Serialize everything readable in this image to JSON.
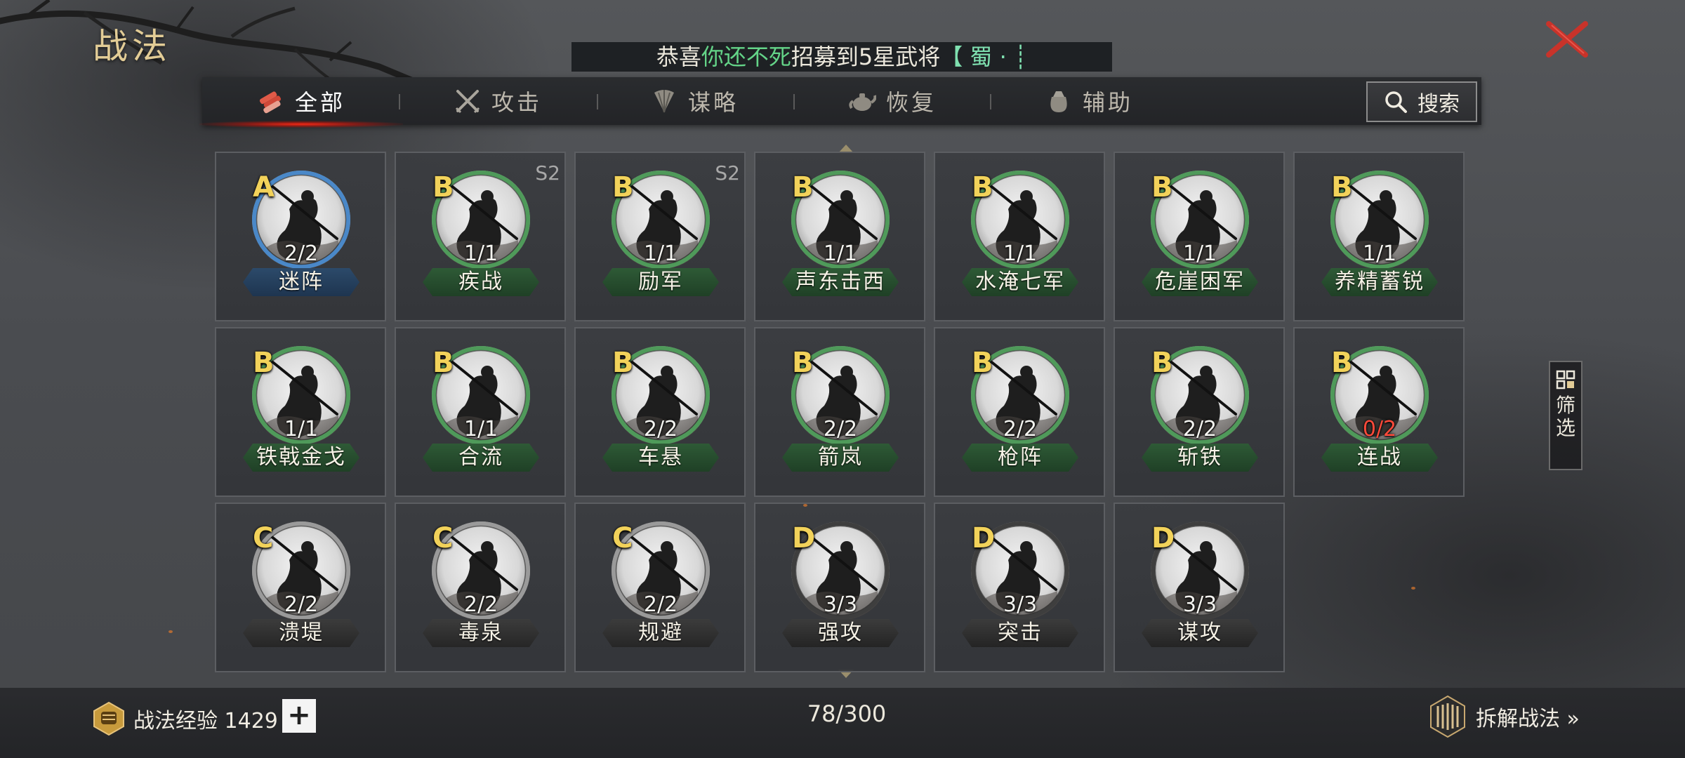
{
  "page_title": "战法",
  "notice": {
    "prefix": "恭喜",
    "name": "你还不死",
    "middle": "招募到5星武将",
    "suffix": "【 蜀 · ┊"
  },
  "tabs": [
    {
      "label": "全部",
      "icon": "scroll-bundle-icon",
      "active": true
    },
    {
      "label": "攻击",
      "icon": "crossed-swords-icon",
      "active": false
    },
    {
      "label": "谋略",
      "icon": "feather-fan-icon",
      "active": false
    },
    {
      "label": "恢复",
      "icon": "teapot-icon",
      "active": false
    },
    {
      "label": "辅助",
      "icon": "pouch-icon",
      "active": false
    }
  ],
  "search": {
    "label": "搜索",
    "icon": "magnifier-icon"
  },
  "tactics": [
    {
      "grade": "A",
      "count": "2/2",
      "name": "迷阵",
      "season": "",
      "color": "blue"
    },
    {
      "grade": "B",
      "count": "1/1",
      "name": "疾战",
      "season": "S2",
      "color": "green"
    },
    {
      "grade": "B",
      "count": "1/1",
      "name": "励军",
      "season": "S2",
      "color": "green"
    },
    {
      "grade": "B",
      "count": "1/1",
      "name": "声东击西",
      "season": "",
      "color": "green"
    },
    {
      "grade": "B",
      "count": "1/1",
      "name": "水淹七军",
      "season": "",
      "color": "green"
    },
    {
      "grade": "B",
      "count": "1/1",
      "name": "危崖困军",
      "season": "",
      "color": "green"
    },
    {
      "grade": "B",
      "count": "1/1",
      "name": "养精蓄锐",
      "season": "",
      "color": "green"
    },
    {
      "grade": "B",
      "count": "1/1",
      "name": "铁戟金戈",
      "season": "",
      "color": "green"
    },
    {
      "grade": "B",
      "count": "1/1",
      "name": "合流",
      "season": "",
      "color": "green"
    },
    {
      "grade": "B",
      "count": "2/2",
      "name": "车悬",
      "season": "",
      "color": "green"
    },
    {
      "grade": "B",
      "count": "2/2",
      "name": "箭岚",
      "season": "",
      "color": "green"
    },
    {
      "grade": "B",
      "count": "2/2",
      "name": "枪阵",
      "season": "",
      "color": "green"
    },
    {
      "grade": "B",
      "count": "2/2",
      "name": "斩铁",
      "season": "",
      "color": "green"
    },
    {
      "grade": "B",
      "count": "0/2",
      "name": "连战",
      "season": "",
      "color": "green"
    },
    {
      "grade": "C",
      "count": "2/2",
      "name": "溃堤",
      "season": "",
      "color": "gray"
    },
    {
      "grade": "C",
      "count": "2/2",
      "name": "毒泉",
      "season": "",
      "color": "gray"
    },
    {
      "grade": "C",
      "count": "2/2",
      "name": "规避",
      "season": "",
      "color": "gray"
    },
    {
      "grade": "D",
      "count": "3/3",
      "name": "强攻",
      "season": "",
      "color": "dark"
    },
    {
      "grade": "D",
      "count": "3/3",
      "name": "突击",
      "season": "",
      "color": "dark"
    },
    {
      "grade": "D",
      "count": "3/3",
      "name": "谋攻",
      "season": "",
      "color": "dark"
    }
  ],
  "filter": {
    "label": "筛选",
    "icon": "grid-filter-icon"
  },
  "footer": {
    "exp_label": "战法经验 1429",
    "plus": "+",
    "capacity": "78/300",
    "dismantle_label": "拆解战法 »"
  },
  "colors": {
    "grade_text": "#f2d25a",
    "blue_ring": "#4a88c8",
    "green_ring": "#4f9a5a",
    "gray_ring": "#9a9a9a",
    "dark_ring": "#3e3e3e",
    "tab_active_glow": "#ff2814",
    "notice_highlight": "#64d488",
    "count_zero": "#ff4a3a"
  }
}
